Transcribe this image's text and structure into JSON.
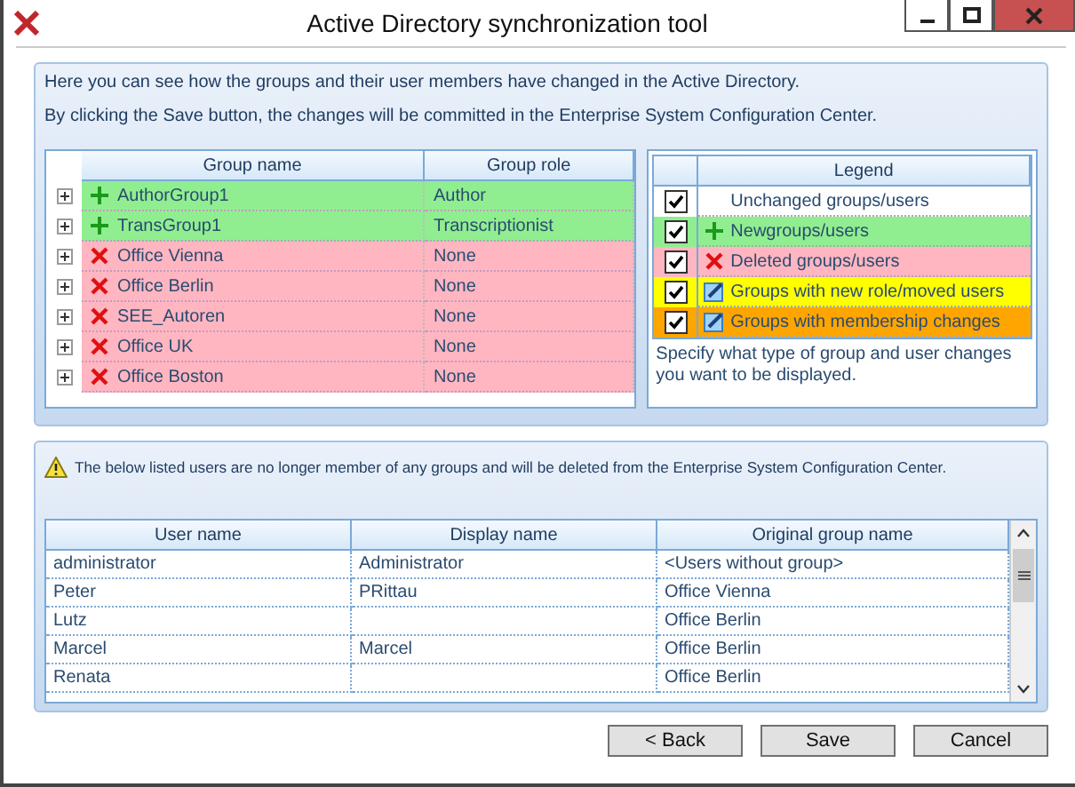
{
  "window": {
    "title": "Active Directory synchronization tool"
  },
  "intro": [
    "Here you can see how the groups and their user members have changed in the Active Directory.",
    "By clicking the Save button, the changes will be committed in the Enterprise System Configuration Center."
  ],
  "groups": {
    "columns": [
      "Group name",
      "Group role"
    ],
    "rows": [
      {
        "kind": "new",
        "name": "AuthorGroup1",
        "role": "Author"
      },
      {
        "kind": "new",
        "name": "TransGroup1",
        "role": "Transcriptionist"
      },
      {
        "kind": "deleted",
        "name": "Office Vienna",
        "role": "None"
      },
      {
        "kind": "deleted",
        "name": "Office Berlin",
        "role": "None"
      },
      {
        "kind": "deleted",
        "name": "SEE_Autoren",
        "role": "None"
      },
      {
        "kind": "deleted",
        "name": "Office UK",
        "role": "None"
      },
      {
        "kind": "deleted",
        "name": "Office Boston",
        "role": "None"
      }
    ]
  },
  "legend": {
    "title": "Legend",
    "items": [
      {
        "kind": "unchanged",
        "label": "Unchanged groups/users",
        "checked": true
      },
      {
        "kind": "new",
        "label": "Newgroups/users",
        "checked": true
      },
      {
        "kind": "deleted",
        "label": "Deleted groups/users",
        "checked": true
      },
      {
        "kind": "role",
        "label": "Groups with new role/moved users",
        "checked": true
      },
      {
        "kind": "membership",
        "label": "Groups with membership changes",
        "checked": true
      }
    ],
    "hint": "Specify what type of group and user changes you want to be displayed."
  },
  "warning": "The below listed users are no longer member of any groups and will be deleted from the Enterprise System Configuration Center.",
  "users": {
    "columns": [
      "User name",
      "Display name",
      "Original group name"
    ],
    "rows": [
      [
        "administrator",
        "Administrator",
        "<Users without group>"
      ],
      [
        "Peter",
        "PRittau",
        "Office Vienna"
      ],
      [
        "Lutz",
        "",
        "Office Berlin"
      ],
      [
        "Marcel",
        "Marcel",
        "Office Berlin"
      ],
      [
        "Renata",
        "",
        "Office Berlin"
      ]
    ]
  },
  "buttons": [
    "< Back",
    "Save",
    "Cancel"
  ]
}
